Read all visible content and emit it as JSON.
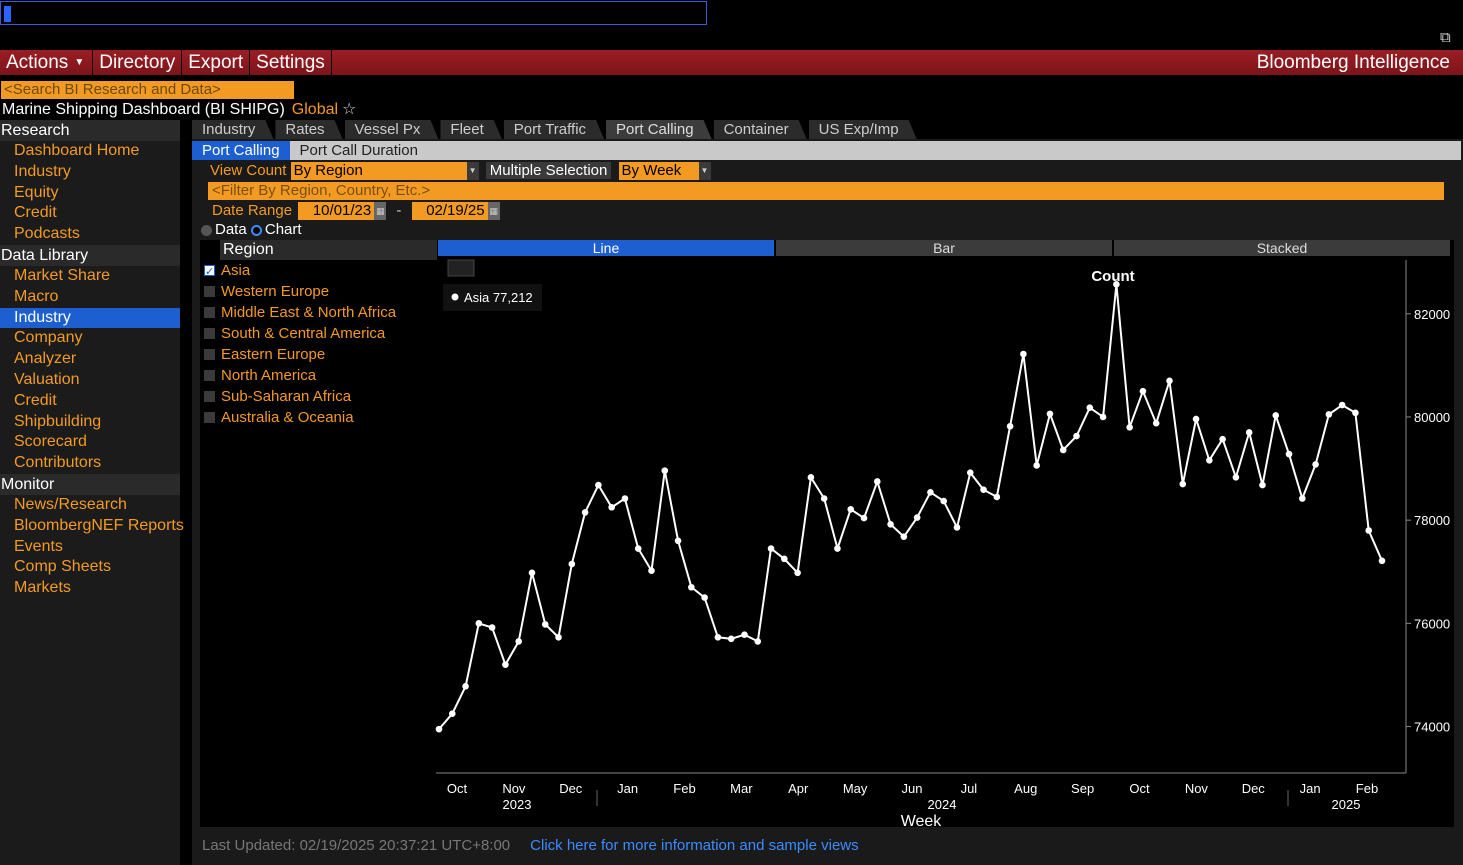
{
  "menu": {
    "actions": "Actions",
    "directory": "Directory",
    "export": "Export",
    "settings": "Settings",
    "brand": "Bloomberg Intelligence"
  },
  "search": {
    "placeholder": "<Search BI Research and Data>"
  },
  "dashboard": {
    "title": "Marine Shipping Dashboard (BI SHIPG)",
    "scope": "Global"
  },
  "sidebar": {
    "research": {
      "label": "Research",
      "items": [
        "Dashboard Home",
        "Industry",
        "Equity",
        "Credit",
        "Podcasts"
      ]
    },
    "data_library": {
      "label": "Data Library",
      "items": [
        "Market Share",
        "Macro",
        "Industry",
        "Company",
        "Analyzer",
        "Valuation",
        "Credit",
        "Shipbuilding",
        "Scorecard",
        "Contributors"
      ],
      "active_index": 2
    },
    "monitor": {
      "label": "Monitor",
      "items": [
        "News/Research",
        "BloombergNEF Reports",
        "Events",
        "Comp Sheets",
        "Markets"
      ]
    }
  },
  "tabs": [
    "Industry",
    "Rates",
    "Vessel Px",
    "Fleet",
    "Port Traffic",
    "Port Calling",
    "Container",
    "US Exp/Imp"
  ],
  "active_tab": "Port Calling",
  "subtabs": [
    "Port Calling",
    "Port Call Duration"
  ],
  "controls": {
    "view_count_label": "View Count",
    "view_count_value": "By Region",
    "multiple_selection": "Multiple Selection",
    "period_value": "By Week",
    "filter_placeholder": "<Filter By Region, Country, Etc.>",
    "date_range_label": "Date Range",
    "date_from": "10/01/23",
    "date_sep": "-",
    "date_to": "02/19/25",
    "mode_data": "Data",
    "mode_chart": "Chart"
  },
  "region": {
    "header": "Region",
    "items": [
      {
        "name": "Asia",
        "checked": true
      },
      {
        "name": "Western Europe",
        "checked": false
      },
      {
        "name": "Middle East & North Africa",
        "checked": false
      },
      {
        "name": "South & Central America",
        "checked": false
      },
      {
        "name": "Eastern Europe",
        "checked": false
      },
      {
        "name": "North America",
        "checked": false
      },
      {
        "name": "Sub-Saharan Africa",
        "checked": false
      },
      {
        "name": "Australia & Oceania",
        "checked": false
      }
    ]
  },
  "chart_tabs": [
    "Line",
    "Bar",
    "Stacked"
  ],
  "active_chart_tab": "Line",
  "chart_data": {
    "type": "line",
    "title": "Count",
    "xlabel": "Week",
    "ylabel": "",
    "ylim": [
      73100,
      83100
    ],
    "yticks": [
      74000,
      76000,
      78000,
      80000,
      82000
    ],
    "ytick_labels": [
      "74000",
      "76000",
      "78000",
      "80000",
      "82000"
    ],
    "month_labels": [
      "Oct",
      "Nov",
      "Dec",
      "Jan",
      "Feb",
      "Mar",
      "Apr",
      "May",
      "Jun",
      "Jul",
      "Aug",
      "Sep",
      "Oct",
      "Nov",
      "Dec",
      "Jan",
      "Feb"
    ],
    "year_labels": [
      "2023",
      "2024",
      "2025"
    ],
    "grid": false,
    "legend": {
      "series": "Asia",
      "value": "77,212",
      "placement": "top-left"
    },
    "series": [
      {
        "name": "Asia",
        "color": "#ffffff",
        "values": [
          73950,
          74250,
          74780,
          76000,
          75920,
          75200,
          75650,
          76980,
          75980,
          75730,
          77150,
          78150,
          78680,
          78250,
          78420,
          77450,
          77020,
          78960,
          77600,
          76700,
          76500,
          75730,
          75700,
          75780,
          75650,
          77450,
          77250,
          76980,
          78830,
          78420,
          77450,
          78210,
          78040,
          78750,
          77920,
          77680,
          78050,
          78540,
          78370,
          77860,
          78920,
          78590,
          78450,
          79820,
          81220,
          79060,
          80060,
          79360,
          79630,
          80180,
          80000,
          82570,
          79800,
          80500,
          79880,
          80700,
          78700,
          79960,
          79160,
          79570,
          78830,
          79700,
          78680,
          80030,
          79280,
          78420,
          79080,
          80050,
          80230,
          80080,
          77800,
          77212
        ]
      }
    ]
  },
  "footer": {
    "last_updated": "Last Updated: 02/19/2025 20:37:21 UTC+8:00",
    "link": "Click here for more information and sample views"
  }
}
